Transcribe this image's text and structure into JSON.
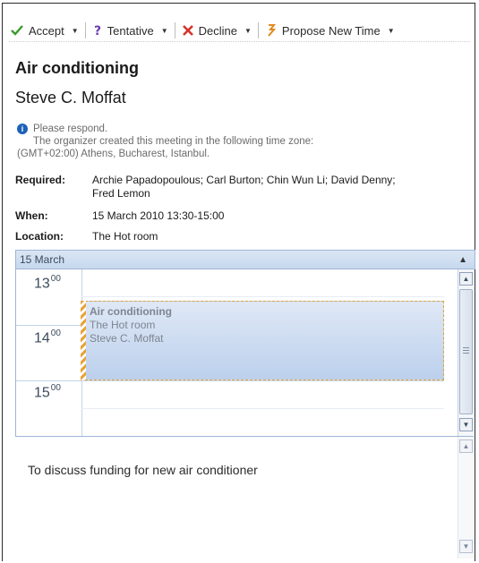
{
  "toolbar": {
    "accept_label": "Accept",
    "tentative_label": "Tentative",
    "decline_label": "Decline",
    "propose_label": "Propose New Time"
  },
  "meeting": {
    "subject": "Air conditioning",
    "organizer": "Steve C. Moffat",
    "info_lines": [
      "Please respond.",
      "The organizer created this meeting in the following time zone:",
      "(GMT+02:00) Athens, Bucharest, Istanbul."
    ],
    "required_label": "Required:",
    "required_value_line1": "Archie Papadopoulous; Carl Burton; Chin Wun Li; David Denny;",
    "required_value_line2": "Fred Lemon",
    "when_label": "When:",
    "when_value": "15 March 2010 13:30-15:00",
    "location_label": "Location:",
    "location_value": "The Hot room"
  },
  "calendar": {
    "date_label": "15 March",
    "hours": [
      {
        "hour": "13",
        "minutes": "00"
      },
      {
        "hour": "14",
        "minutes": "00"
      },
      {
        "hour": "15",
        "minutes": "00"
      }
    ],
    "appointment": {
      "subject": "Air conditioning",
      "location": "The Hot room",
      "organizer": "Steve C. Moffat"
    }
  },
  "notes": {
    "text": "To discuss funding for new air conditioner"
  },
  "colors": {
    "accept_green": "#3a9a2c",
    "decline_red": "#d8332a",
    "tentative_purple": "#6c3fb0",
    "appointment_border": "#e0a23a",
    "info_blue": "#1d61b8"
  },
  "icons": {
    "accept": "check-icon",
    "tentative": "question-icon",
    "decline": "x-icon",
    "propose": "propose-time-icon",
    "info": "info-icon"
  }
}
